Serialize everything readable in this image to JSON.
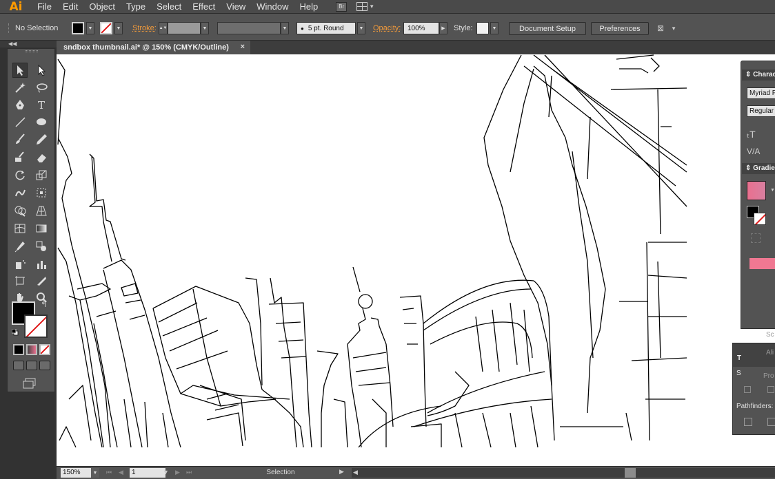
{
  "app": {
    "logo_text": "Ai"
  },
  "menu": [
    "File",
    "Edit",
    "Object",
    "Type",
    "Select",
    "Effect",
    "View",
    "Window",
    "Help"
  ],
  "bridge_label": "Br",
  "controlbar": {
    "selection_status": "No Selection",
    "fill_color": "#000000",
    "stroke_label": "Stroke:",
    "brush_label": "5 pt. Round",
    "opacity_label": "Opacity:",
    "opacity_value": "100%",
    "style_label": "Style:",
    "document_setup": "Document Setup",
    "preferences": "Preferences"
  },
  "tab": {
    "title": "sndbox thumbnail.ai* @ 150% (CMYK/Outline)",
    "close": "×"
  },
  "tools": [
    "selection-tool",
    "direct-selection-tool",
    "magic-wand-tool",
    "lasso-tool",
    "pen-tool",
    "type-tool",
    "line-tool",
    "ellipse-tool",
    "paintbrush-tool",
    "pencil-tool",
    "blob-brush-tool",
    "eraser-tool",
    "rotate-tool",
    "scale-tool",
    "warp-tool",
    "free-transform-tool",
    "shape-builder-tool",
    "perspective-grid-tool",
    "mesh-tool",
    "gradient-tool",
    "eyedropper-tool",
    "blend-tool",
    "symbol-sprayer-tool",
    "column-graph-tool",
    "artboard-tool",
    "slice-tool",
    "hand-tool",
    "zoom-tool"
  ],
  "character_panel": {
    "title": "Charact",
    "font_family": "Myriad P",
    "font_style": "Regular"
  },
  "gradient_panel": {
    "title": "Gradien",
    "swatch_color": "#e9708f",
    "bar_color": "#f07892"
  },
  "pathfinder_panel": {
    "title_letter": "T",
    "shape_modes_letter": "S",
    "scale_text": "Sc",
    "align_text": "Ali",
    "profile_text": "Pro",
    "pathfinders_label": "Pathfinders:"
  },
  "statusbar": {
    "zoom": "150%",
    "page": "1",
    "status_text": "Selection"
  },
  "colors": {
    "accent_orange": "#ff9a00",
    "label_orange": "#f19a3b"
  }
}
